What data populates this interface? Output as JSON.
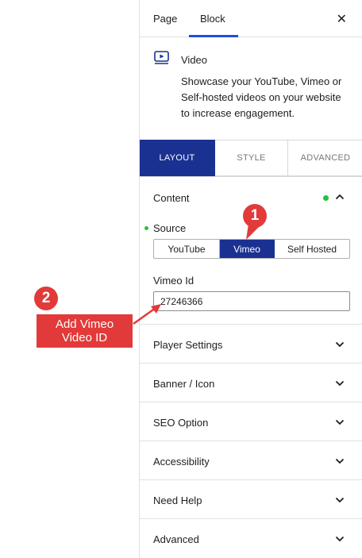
{
  "top_tabs": {
    "page": "Page",
    "block": "Block",
    "close_icon": "close-icon"
  },
  "block": {
    "icon": "video-icon",
    "title": "Video",
    "description": "Showcase your YouTube, Vimeo or Self-hosted videos on your website to increase engagement."
  },
  "panel_tabs": [
    "LAYOUT",
    "STYLE",
    "ADVANCED"
  ],
  "content": {
    "title": "Content",
    "source_label": "Source",
    "source_options": [
      "YouTube",
      "Vimeo",
      "Self Hosted"
    ],
    "source_selected": "Vimeo",
    "vimeo_id_label": "Vimeo Id",
    "vimeo_id_value": "27246366"
  },
  "sections": [
    "Player Settings",
    "Banner / Icon",
    "SEO Option",
    "Accessibility",
    "Need Help",
    "Advanced"
  ],
  "annotations": {
    "badge_1": "1",
    "badge_2": "2",
    "callout_line1": "Add Vimeo",
    "callout_line2": "Video ID"
  },
  "colors": {
    "accent": "#1a3192",
    "tab_underline": "#1e4fd8",
    "annotation": "#e23a3a",
    "indicator": "#22c33a"
  }
}
